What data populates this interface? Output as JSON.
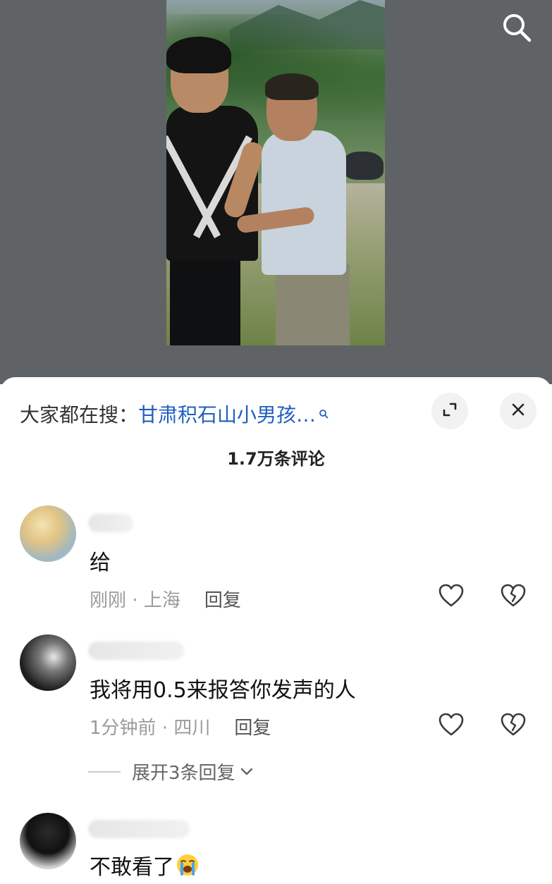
{
  "search": {
    "label": "大家都在搜：",
    "query": "甘肃积石山小男孩…"
  },
  "comments_header": {
    "count": "1.7万条评论"
  },
  "comments": [
    {
      "text": "给",
      "time": "刚刚",
      "location": "上海",
      "reply_label": "回复"
    },
    {
      "text": "我将用0.5来报答你发声的人",
      "time": "1分钟前",
      "location": "四川",
      "reply_label": "回复",
      "expand_label": "展开3条回复"
    },
    {
      "text": "不敢看了",
      "emoji": "crying-face"
    }
  ],
  "meta_separator": " · ",
  "colors": {
    "video_background": "#5f6366",
    "search_query": "#1f5fbf",
    "meta_text": "#9b9b9b"
  }
}
